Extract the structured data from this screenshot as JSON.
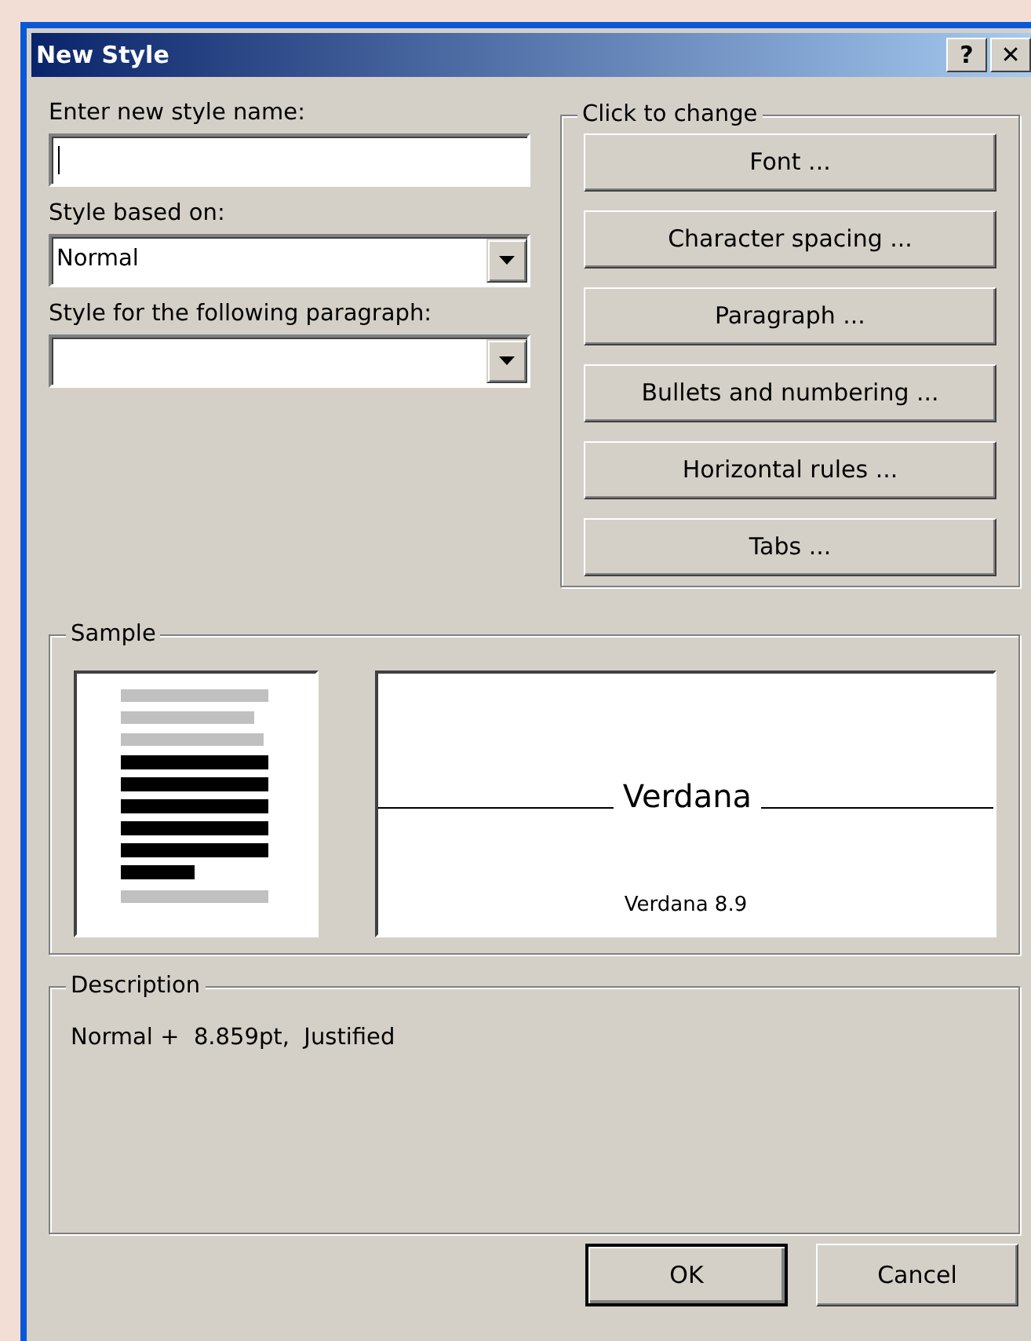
{
  "window": {
    "title": "New Style",
    "title_buttons": [
      "?",
      "✕"
    ]
  },
  "name_field": {
    "label": "Enter new style name:",
    "focused": true
  },
  "based_on": {
    "label": "Style based on:",
    "value": "Normal"
  },
  "following": {
    "label": "Style for the following paragraph:"
  },
  "click_to_change": {
    "title": "Click to change",
    "buttons": [
      "Font ...",
      "Character spacing ...",
      "Paragraph ...",
      "Bullets and numbering ...",
      "Horizontal rules ...",
      "Tabs ..."
    ]
  },
  "sample": {
    "title": "Sample",
    "font_preview": "Verdana",
    "font_caption": "Verdana 8.9"
  },
  "description": {
    "title": "Description",
    "text": "Normal +  8.859pt,  Justified"
  },
  "buttons": [
    {
      "label": "OK",
      "default": true
    },
    {
      "label": "Cancel",
      "default": false
    }
  ]
}
